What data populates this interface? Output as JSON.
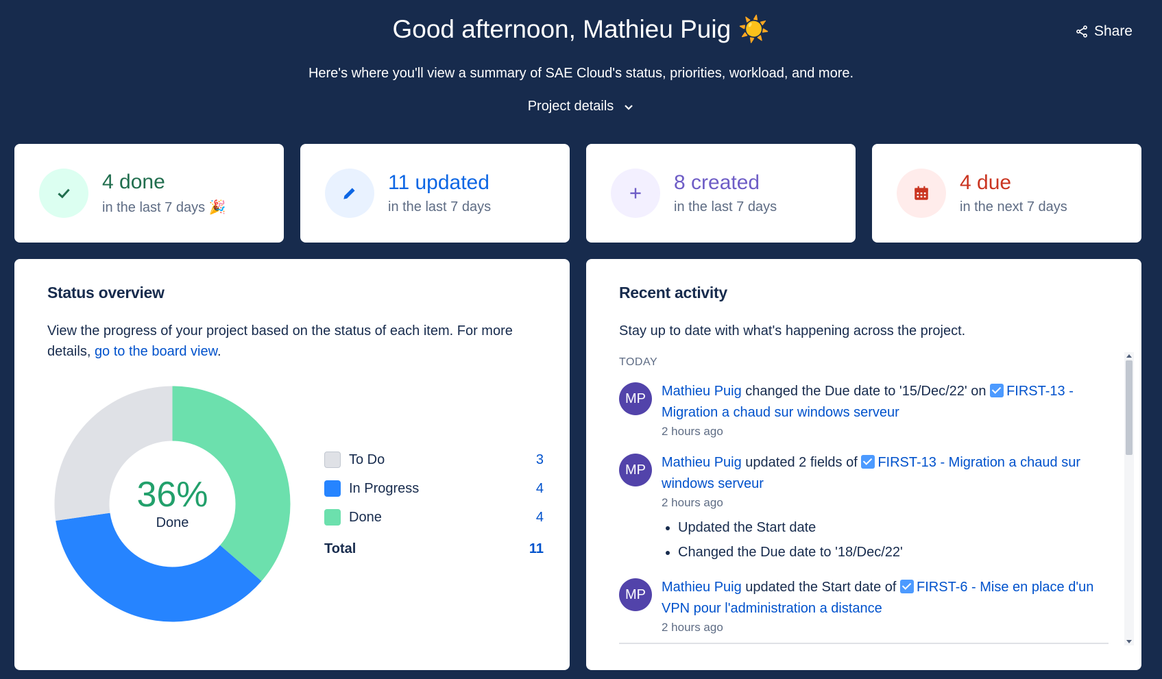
{
  "header": {
    "greeting": "Good afternoon, Mathieu Puig",
    "greeting_emoji": "☀️",
    "subtitle": "Here's where you'll view a summary of SAE Cloud's status, priorities, workload, and more.",
    "project_details_label": "Project details",
    "share_label": "Share"
  },
  "stats": [
    {
      "main": "4 done",
      "sub": "in the last 7 days 🎉",
      "color": "#216e4e",
      "icon_bg": "#dcfff1",
      "icon": "check-icon"
    },
    {
      "main": "11 updated",
      "sub": "in the last 7 days",
      "color": "#0c66e4",
      "icon_bg": "#e9f2ff",
      "icon": "pencil-icon"
    },
    {
      "main": "8 created",
      "sub": "in the last 7 days",
      "color": "#6e5dc6",
      "icon_bg": "#f3f0ff",
      "icon": "plus-icon"
    },
    {
      "main": "4 due",
      "sub": "in the next 7 days",
      "color": "#ca3521",
      "icon_bg": "#ffeceb",
      "icon": "calendar-icon"
    }
  ],
  "status_overview": {
    "title": "Status overview",
    "desc_prefix": "View the progress of your project based on the status of each item. For more details, ",
    "desc_link": "go to the board view",
    "desc_suffix": ".",
    "center_value": "36%",
    "center_label": "Done",
    "legend": [
      {
        "name": "To Do",
        "count": "3",
        "color": "#dfe1e6"
      },
      {
        "name": "In Progress",
        "count": "4",
        "color": "#2684ff"
      },
      {
        "name": "Done",
        "count": "4",
        "color": "#6ce0ad"
      }
    ],
    "total_label": "Total",
    "total_count": "11"
  },
  "chart_data": {
    "type": "pie",
    "categories": [
      "To Do",
      "In Progress",
      "Done"
    ],
    "values": [
      3,
      4,
      4
    ],
    "colors": [
      "#dfe1e6",
      "#2684ff",
      "#6ce0ad"
    ],
    "title": "Status overview"
  },
  "recent_activity": {
    "title": "Recent activity",
    "desc": "Stay up to date with what's happening across the project.",
    "group_label": "TODAY",
    "items": [
      {
        "avatar": "MP",
        "user": "Mathieu Puig",
        "action": " changed the Due date to '15/Dec/22' on ",
        "issue": "FIRST-13 - Migration a chaud sur windows serveur",
        "time": "2 hours ago",
        "bullets": []
      },
      {
        "avatar": "MP",
        "user": "Mathieu Puig",
        "action": " updated 2 fields of ",
        "issue": "FIRST-13 - Migration a chaud sur windows serveur",
        "time": "2 hours ago",
        "bullets": [
          "Updated the Start date",
          "Changed the Due date to '18/Dec/22'"
        ]
      },
      {
        "avatar": "MP",
        "user": "Mathieu Puig",
        "action": " updated the Start date of ",
        "issue": "FIRST-6 - Mise en place d'un VPN pour l'administration a distance",
        "time": "2 hours ago",
        "bullets": []
      }
    ]
  }
}
